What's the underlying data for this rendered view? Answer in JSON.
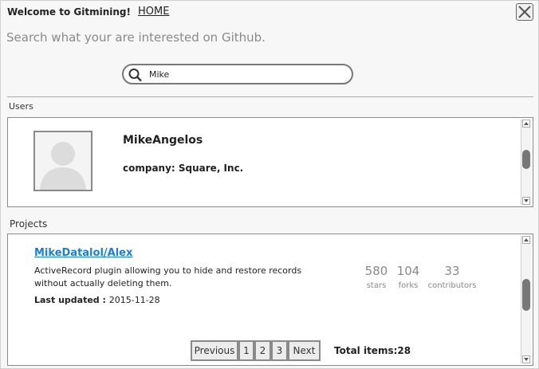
{
  "header": {
    "welcome": "Welcome to Gitmining!",
    "home_link": "HOME",
    "subtitle": "Search what your are interested on Github."
  },
  "search": {
    "value": "Mike",
    "icon": "search-icon"
  },
  "users": {
    "label": "Users",
    "items": [
      {
        "name": "MikeAngelos",
        "company": "company: Square, Inc."
      }
    ]
  },
  "projects": {
    "label": "Projects",
    "items": [
      {
        "name": "MikeDatalol/Alex",
        "description": "ActiveRecord plugin allowing you to hide and restore records without actually deleting them.",
        "last_updated_label": "Last updated : ",
        "last_updated": "2015-11-28",
        "stars": "580",
        "stars_label": "stars",
        "forks": "104",
        "forks_label": "forks",
        "contributors": "33",
        "contributors_label": "contributors"
      }
    ],
    "pagination": {
      "previous": "Previous",
      "pages": [
        "1",
        "2",
        "3"
      ],
      "next": "Next",
      "total": "Total items:28"
    }
  },
  "colors": {
    "link": "#1a7fd6",
    "stat_text": "#888888",
    "border": "#8a8a8a"
  }
}
